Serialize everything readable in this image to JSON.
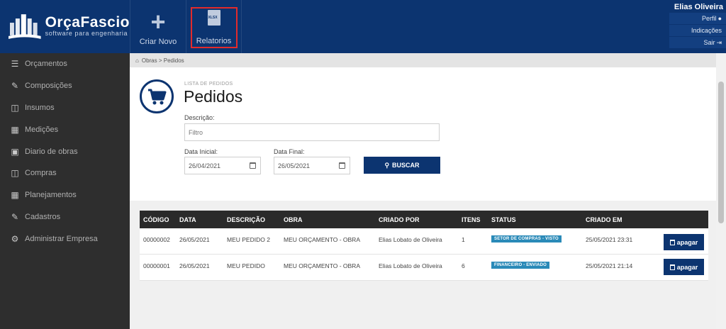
{
  "brand": {
    "name": "OrçaFascio",
    "tagline": "software para engenharia"
  },
  "toolbar": {
    "create_label": "Criar Novo",
    "reports_label": "Relatorios",
    "reports_file_badge": "XLSX"
  },
  "user": {
    "name": "Elias Oliveira",
    "links": [
      "Perfil",
      "Indicações",
      "Sair"
    ]
  },
  "sidebar": {
    "items": [
      {
        "label": "Orçamentos",
        "icon": "list-icon"
      },
      {
        "label": "Composições",
        "icon": "eraser-icon"
      },
      {
        "label": "Insumos",
        "icon": "stack-icon"
      },
      {
        "label": "Medições",
        "icon": "measure-icon"
      },
      {
        "label": "Diario de obras",
        "icon": "book-icon"
      },
      {
        "label": "Compras",
        "icon": "cart-icon"
      },
      {
        "label": "Planejamentos",
        "icon": "calendar-icon"
      },
      {
        "label": "Cadastros",
        "icon": "edit-icon"
      },
      {
        "label": "Administrar Empresa",
        "icon": "gear-icon"
      }
    ]
  },
  "breadcrumb": {
    "items": [
      "Obras",
      "Pedidos"
    ]
  },
  "page": {
    "list_label": "LISTA DE PEDIDOS",
    "title": "Pedidos"
  },
  "filters": {
    "description_label": "Descrição:",
    "description_placeholder": "Filtro",
    "start_label": "Data Inicial:",
    "start_value": "26/04/2021",
    "end_label": "Data Final:",
    "end_value": "26/05/2021",
    "search_label": "BUSCAR"
  },
  "table": {
    "columns": [
      "CÓDIGO",
      "DATA",
      "DESCRIÇÃO",
      "OBRA",
      "CRIADO POR",
      "ITENS",
      "STATUS",
      "CRIADO EM"
    ],
    "delete_label": "apagar",
    "rows": [
      {
        "codigo": "00000002",
        "data": "26/05/2021",
        "descricao": "MEU PEDIDO 2",
        "obra": "MEU ORÇAMENTO - OBRA",
        "criado_por": "Elias Lobato de Oliveira",
        "itens": "1",
        "status": "SETOR DE COMPRAS - VISTO",
        "criado_em": "25/05/2021 23:31"
      },
      {
        "codigo": "00000001",
        "data": "26/05/2021",
        "descricao": "MEU PEDIDO",
        "obra": "MEU ORÇAMENTO - OBRA",
        "criado_por": "Elias Lobato de Oliveira",
        "itens": "6",
        "status": "FINANCEIRO - ENVIADO",
        "criado_em": "25/05/2021 21:14"
      }
    ]
  },
  "colors": {
    "navy": "#0c3470",
    "sidebar": "#2e2e2e",
    "badge": "#2a8ab8",
    "highlight": "#e32b2b"
  }
}
